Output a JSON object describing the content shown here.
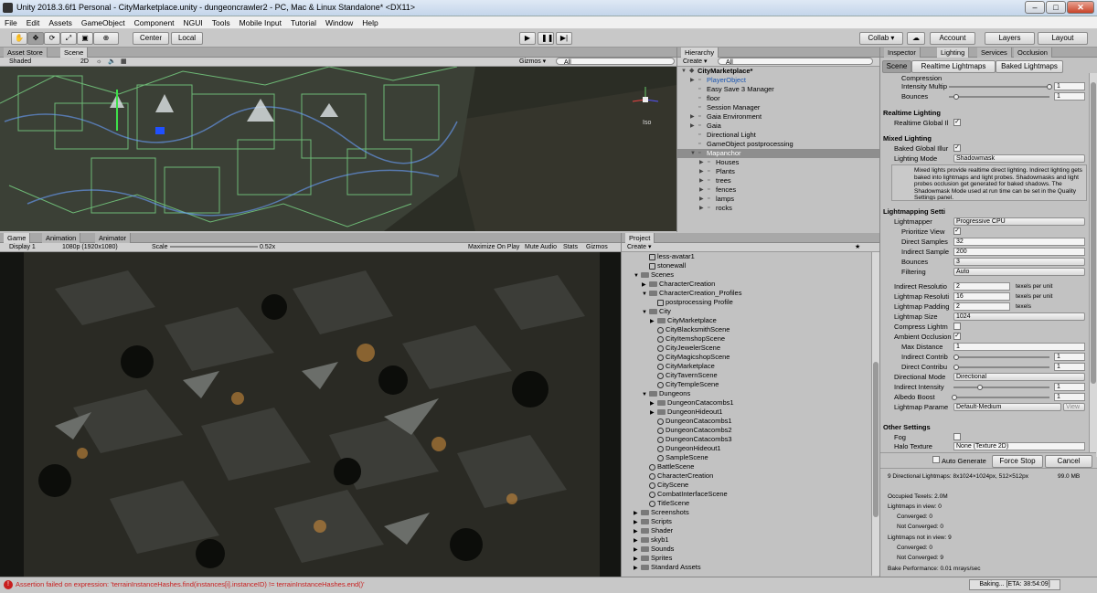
{
  "window": {
    "title": "Unity 2018.3.6f1 Personal - CityMarketplace.unity - dungeoncrawler2 - PC, Mac & Linux Standalone* <DX11>"
  },
  "menu": [
    "File",
    "Edit",
    "Assets",
    "GameObject",
    "Component",
    "NGUI",
    "Tools",
    "Mobile Input",
    "Tutorial",
    "Window",
    "Help"
  ],
  "toolbar": {
    "center": "Center",
    "local": "Local",
    "collab": "Collab ▾",
    "account": "Account",
    "layers": "Layers",
    "layout": "Layout"
  },
  "scene_panel": {
    "tabs": [
      "Asset Store",
      "Scene"
    ],
    "shading": "Shaded",
    "mode2d": "2D",
    "gizmos": "Gizmos ▾",
    "search": "All",
    "persp": "Iso"
  },
  "game_panel": {
    "tabs": [
      "Game",
      "Animation",
      "Animator"
    ],
    "display": "Display 1",
    "resolution": "1080p (1920x1080)",
    "scale_label": "Scale",
    "scale_value": "0.52x",
    "maximize": "Maximize On Play",
    "mute": "Mute Audio",
    "stats": "Stats",
    "gizmos": "Gizmos"
  },
  "hierarchy": {
    "title": "Hierarchy",
    "create": "Create ▾",
    "search": "All",
    "rows": [
      {
        "label": "CityMarketplace*",
        "indent": 0,
        "arrow": "▼",
        "bold": true
      },
      {
        "label": "PlayerObject",
        "indent": 1,
        "arrow": "▶",
        "color": "#1a55b0"
      },
      {
        "label": "Easy Save 3 Manager",
        "indent": 1,
        "arrow": ""
      },
      {
        "label": "floor",
        "indent": 1,
        "arrow": ""
      },
      {
        "label": "Session Manager",
        "indent": 1,
        "arrow": ""
      },
      {
        "label": "Gaia Environment",
        "indent": 1,
        "arrow": "▶"
      },
      {
        "label": "Gaia",
        "indent": 1,
        "arrow": "▶"
      },
      {
        "label": "Directional Light",
        "indent": 1,
        "arrow": ""
      },
      {
        "label": "GameObject postprocessing",
        "indent": 1,
        "arrow": ""
      },
      {
        "label": "Mapanchor",
        "indent": 1,
        "arrow": "▼",
        "sel": true
      },
      {
        "label": "Houses",
        "indent": 2,
        "arrow": "▶"
      },
      {
        "label": "Plants",
        "indent": 2,
        "arrow": "▶"
      },
      {
        "label": "trees",
        "indent": 2,
        "arrow": "▶"
      },
      {
        "label": "fences",
        "indent": 2,
        "arrow": "▶"
      },
      {
        "label": "lamps",
        "indent": 2,
        "arrow": "▶"
      },
      {
        "label": "rocks",
        "indent": 2,
        "arrow": "▶"
      }
    ]
  },
  "project": {
    "title": "Project",
    "create": "Create ▾",
    "rows": [
      {
        "label": "less-avatar1",
        "indent": 2,
        "kind": "file"
      },
      {
        "label": "stonewall",
        "indent": 2,
        "kind": "file"
      },
      {
        "label": "Scenes",
        "indent": 1,
        "kind": "folder",
        "arrow": "▼"
      },
      {
        "label": "CharacterCreation",
        "indent": 2,
        "kind": "folder",
        "arrow": "▶"
      },
      {
        "label": "CharacterCreation_Profiles",
        "indent": 2,
        "kind": "folder",
        "arrow": "▼"
      },
      {
        "label": "postprocessing Profile",
        "indent": 3,
        "kind": "file"
      },
      {
        "label": "City",
        "indent": 2,
        "kind": "folder",
        "arrow": "▼"
      },
      {
        "label": "CityMarketplace",
        "indent": 3,
        "kind": "folder",
        "arrow": "▶"
      },
      {
        "label": "CityBlacksmithScene",
        "indent": 3,
        "kind": "scene"
      },
      {
        "label": "CityItemshopScene",
        "indent": 3,
        "kind": "scene"
      },
      {
        "label": "CityJewelerScene",
        "indent": 3,
        "kind": "scene"
      },
      {
        "label": "CityMagicshopScene",
        "indent": 3,
        "kind": "scene"
      },
      {
        "label": "CityMarketplace",
        "indent": 3,
        "kind": "scene"
      },
      {
        "label": "CityTavernScene",
        "indent": 3,
        "kind": "scene"
      },
      {
        "label": "CityTempleScene",
        "indent": 3,
        "kind": "scene"
      },
      {
        "label": "Dungeons",
        "indent": 2,
        "kind": "folder",
        "arrow": "▼"
      },
      {
        "label": "DungeonCatacombs1",
        "indent": 3,
        "kind": "folder",
        "arrow": "▶"
      },
      {
        "label": "DungeonHideout1",
        "indent": 3,
        "kind": "folder",
        "arrow": "▶"
      },
      {
        "label": "DungeonCatacombs1",
        "indent": 3,
        "kind": "scene"
      },
      {
        "label": "DungeonCatacombs2",
        "indent": 3,
        "kind": "scene"
      },
      {
        "label": "DungeonCatacombs3",
        "indent": 3,
        "kind": "scene"
      },
      {
        "label": "DungeonHideout1",
        "indent": 3,
        "kind": "scene"
      },
      {
        "label": "SampleScene",
        "indent": 3,
        "kind": "scene"
      },
      {
        "label": "BattleScene",
        "indent": 2,
        "kind": "scene"
      },
      {
        "label": "CharacterCreation",
        "indent": 2,
        "kind": "scene"
      },
      {
        "label": "CityScene",
        "indent": 2,
        "kind": "scene"
      },
      {
        "label": "CombatInterfaceScene",
        "indent": 2,
        "kind": "scene"
      },
      {
        "label": "TitleScene",
        "indent": 2,
        "kind": "scene"
      },
      {
        "label": "Screenshots",
        "indent": 1,
        "kind": "folder",
        "arrow": "▶"
      },
      {
        "label": "Scripts",
        "indent": 1,
        "kind": "folder",
        "arrow": "▶"
      },
      {
        "label": "Shader",
        "indent": 1,
        "kind": "folder",
        "arrow": "▶"
      },
      {
        "label": "skyb1",
        "indent": 1,
        "kind": "folder",
        "arrow": "▶"
      },
      {
        "label": "Sounds",
        "indent": 1,
        "kind": "folder",
        "arrow": "▶"
      },
      {
        "label": "Sprites",
        "indent": 1,
        "kind": "folder",
        "arrow": "▶"
      },
      {
        "label": "Standard Assets",
        "indent": 1,
        "kind": "folder",
        "arrow": "▶"
      }
    ]
  },
  "inspector": {
    "tabs": [
      "Inspector",
      "Lighting",
      "Services",
      "Occlusion"
    ],
    "subtabs": [
      "Scene",
      "Realtime Lightmaps",
      "Baked Lightmaps"
    ],
    "top": {
      "compression": "Compression",
      "intensity_label": "Intensity Multip",
      "intensity_value": "1",
      "bounces_label": "Bounces",
      "bounces_value": "1"
    },
    "realtime": {
      "title": "Realtime Lighting",
      "gi_label": "Realtime Global Il"
    },
    "mixed": {
      "title": "Mixed Lighting",
      "baked_label": "Baked Global Illur",
      "mode_label": "Lighting Mode",
      "mode_value": "Shadowmask",
      "help": "Mixed lights provide realtime direct lighting. Indirect lighting gets baked into lightmaps and light probes. Shadowmasks and light probes occlusion get generated for baked shadows. The Shadowmask Mode used at run time can be set in the Quality Settings panel."
    },
    "lightmapping": {
      "title": "Lightmapping Setti",
      "lightmapper_label": "Lightmapper",
      "lightmapper_value": "Progressive CPU",
      "prioritize_label": "Prioritize View",
      "direct_samples_label": "Direct Samples",
      "direct_samples_value": "32",
      "indirect_samples_label": "Indirect Sample",
      "indirect_samples_value": "200",
      "bounces_label": "Bounces",
      "bounces_value": "3",
      "filtering_label": "Filtering",
      "filtering_value": "Auto",
      "indirect_res_label": "Indirect Resolutio",
      "indirect_res_value": "2",
      "texels_unit": "texels per unit",
      "lightmap_res_label": "Lightmap Resoluti",
      "lightmap_res_value": "16",
      "padding_label": "Lightmap Padding",
      "padding_value": "2",
      "texels": "texels",
      "size_label": "Lightmap Size",
      "size_value": "1024",
      "compress_label": "Compress Lightm",
      "ao_label": "Ambient Occlusion",
      "max_distance_label": "Max Distance",
      "max_distance_value": "1",
      "indirect_contrib_label": "Indirect Contrib",
      "indirect_contrib_value": "1",
      "direct_contrib_label": "Direct Contribu",
      "direct_contrib_value": "1",
      "directional_label": "Directional Mode",
      "directional_value": "Directional",
      "indirect_intensity_label": "Indirect Intensity",
      "indirect_intensity_value": "1",
      "albedo_label": "Albedo Boost",
      "albedo_value": "1",
      "params_label": "Lightmap Parame",
      "params_value": "Default-Medium",
      "view": "View"
    },
    "other": {
      "title": "Other Settings",
      "fog_label": "Fog",
      "halo_label": "Halo Texture",
      "halo_value": "None (Texture 2D)"
    },
    "bake": {
      "auto": "Auto Generate",
      "force_stop": "Force Stop",
      "cancel": "Cancel"
    },
    "stats": {
      "summary": "9 Directional Lightmaps: 8x1024×1024px, 512×512px",
      "size": "99.0 MB",
      "lines": [
        "Occupied Texels: 2.0M",
        "Lightmaps in view: 0",
        "Converged: 0",
        "Not Converged: 0",
        "Lightmaps not in view: 9",
        "Converged: 0",
        "Not Converged: 9",
        "Bake Performance: 0.01 mrays/sec"
      ]
    }
  },
  "status": {
    "error": "Assertion failed on expression: 'terrainInstanceHashes.find(instances[i].instanceID) != terrainInstanceHashes.end()'",
    "baking": "Baking... [ETA: 38:54:09]"
  },
  "colors": {
    "panel": "#c2c2c2",
    "selection": "#8e8e8e",
    "error": "#c81e1e",
    "scene_bg": "#2a2d24"
  }
}
